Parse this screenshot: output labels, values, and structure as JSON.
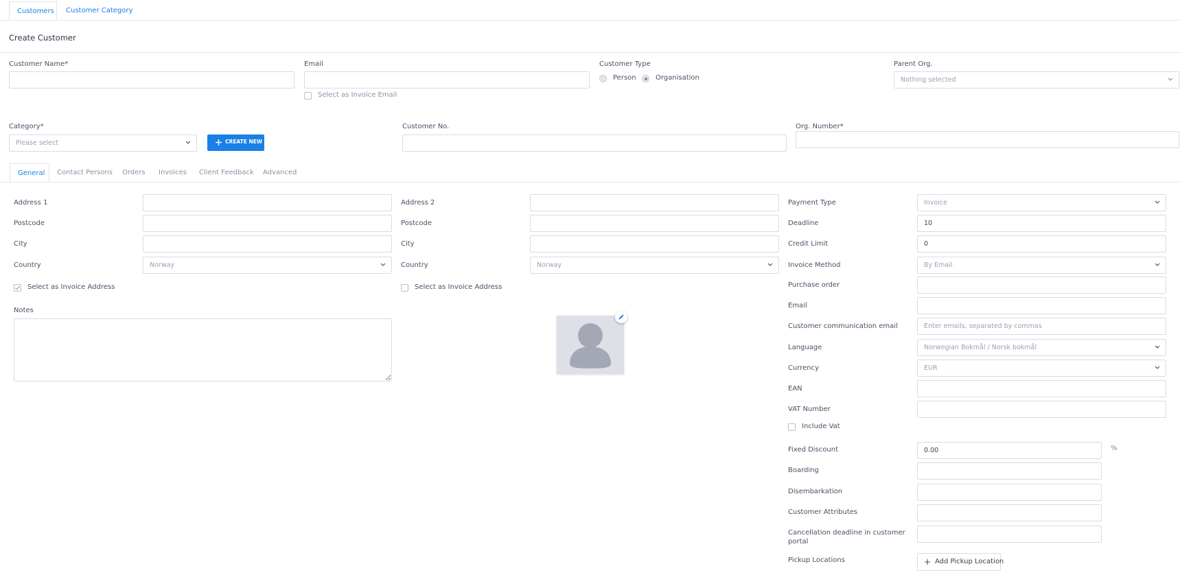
{
  "top_tabs": {
    "customers": "Customers",
    "customer_category": "Customer Category"
  },
  "page_title": "Create Customer",
  "form": {
    "customer_name_label": "Customer Name*",
    "email_label": "Email",
    "select_invoice_email": "Select as Invoice Email",
    "customer_type_label": "Customer Type",
    "type_person": "Person",
    "type_organisation": "Organisation",
    "customer_type_selected": "Organisation",
    "parent_org_label": "Parent Org.",
    "parent_org_value": "Nothing selected",
    "category_label": "Category*",
    "category_value": "Please select",
    "create_new": "CREATE NEW",
    "customer_no_label": "Customer No.",
    "org_number_label": "Org. Number*"
  },
  "sub_tabs": [
    "General",
    "Contact Persons",
    "Orders",
    "Invoices",
    "Client Feedback",
    "Advanced"
  ],
  "active_sub_tab": "General",
  "address1": {
    "address_label": "Address 1",
    "postcode_label": "Postcode",
    "city_label": "City",
    "country_label": "Country",
    "country_value": "Norway",
    "invoice_address": "Select as Invoice Address",
    "invoice_address_checked": true
  },
  "address2": {
    "address_label": "Address 2",
    "postcode_label": "Postcode",
    "city_label": "City",
    "country_label": "Country",
    "country_value": "Norway",
    "invoice_address": "Select as Invoice Address",
    "invoice_address_checked": false
  },
  "notes_label": "Notes",
  "payment": {
    "payment_type_label": "Payment Type",
    "payment_type_value": "Invoice",
    "deadline_label": "Deadline",
    "deadline_value": "10",
    "credit_limit_label": "Credit Limit",
    "credit_limit_value": "0",
    "invoice_method_label": "Invoice Method",
    "invoice_method_value": "By Email",
    "purchase_order_label": "Purchase order",
    "email_label": "Email",
    "comm_email_label": "Customer communication email",
    "comm_email_placeholder": "Enter emails, separated by commas",
    "language_label": "Language",
    "language_value": "Norwegian Bokmål / Norsk bokmål",
    "currency_label": "Currency",
    "currency_value": "EUR",
    "ean_label": "EAN",
    "vat_number_label": "VAT Number",
    "include_vat": "Include Vat",
    "fixed_discount_label": "Fixed Discount",
    "fixed_discount_value": "0.00",
    "percent": "%",
    "boarding_label": "Boarding",
    "disembarkation_label": "Disembarkation",
    "customer_attributes_label": "Customer Attributes",
    "cancellation_label_1": "Cancellation deadline in customer",
    "cancellation_label_2": "portal",
    "pickup_locations_label": "Pickup Locations",
    "add_pickup": "Add Pickup Location"
  },
  "colors": {
    "accent": "#1a7fe6",
    "border": "#d7dbe3",
    "muted": "#9aa1b3",
    "text": "#3a3f51"
  }
}
